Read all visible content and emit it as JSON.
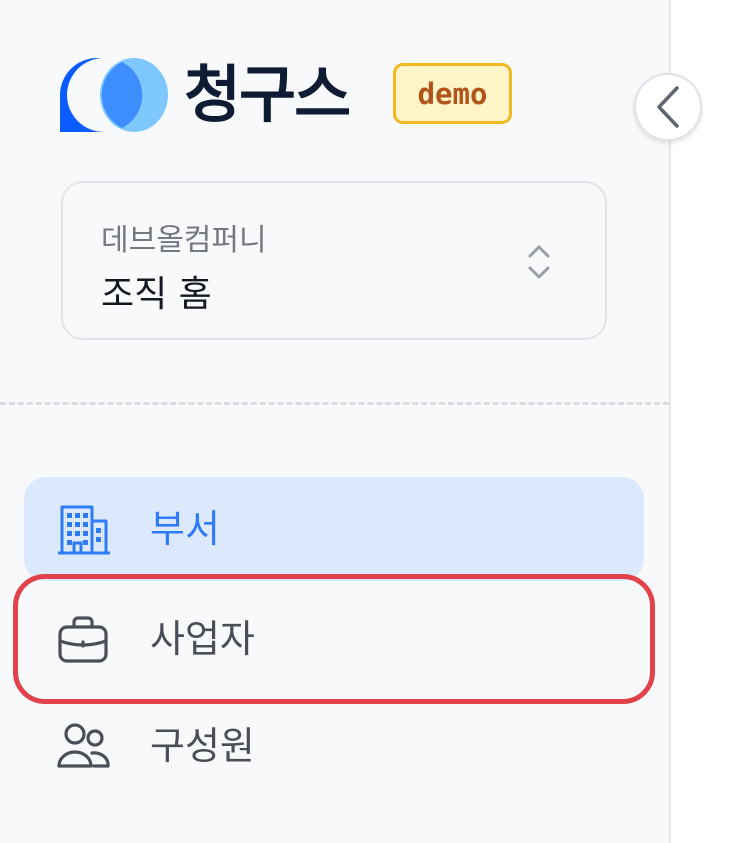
{
  "app": {
    "name": "청구스",
    "badge": "demo"
  },
  "colors": {
    "brand_blue": "#0a5cff",
    "brand_light": "#7ec8ff",
    "active_bg": "#dce9fd",
    "active_text": "#2f7bf6",
    "highlight": "#e2424a"
  },
  "org_selector": {
    "org_name": "데브올컴퍼니",
    "current_page": "조직 홈"
  },
  "nav": {
    "items": [
      {
        "label": "부서",
        "icon": "building-icon",
        "active": true
      },
      {
        "label": "사업자",
        "icon": "briefcase-icon",
        "active": false
      },
      {
        "label": "구성원",
        "icon": "users-icon",
        "active": false
      }
    ]
  }
}
